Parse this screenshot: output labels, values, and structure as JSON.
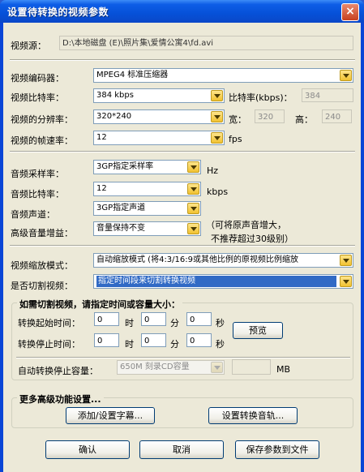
{
  "window": {
    "title": "设置待转换的视频参数",
    "close": "×"
  },
  "source": {
    "label": "视频源：",
    "value": "D:\\本地磁盘 (E)\\照片集\\爱情公寓4\\fd.avi"
  },
  "video": {
    "encoder_label": "视频编码器：",
    "encoder_value": "MPEG4 标准压缩器",
    "bitrate_label": "视频比特率：",
    "bitrate_value": "384 kbps",
    "bitrate_kbps_label": "比特率(kbps)：",
    "bitrate_kbps_value": "384",
    "resolution_label": "视频的分辨率：",
    "resolution_value": "320*240",
    "width_label": "宽：",
    "width_value": "320",
    "height_label": "高：",
    "height_value": "240",
    "framerate_label": "视频的帧速率：",
    "framerate_value": "12",
    "framerate_unit": "fps"
  },
  "audio": {
    "samplerate_label": "音频采样率：",
    "samplerate_value": "3GP指定采样率",
    "samplerate_unit": "Hz",
    "bitrate_label": "音频比特率：",
    "bitrate_value": "12",
    "bitrate_unit": "kbps",
    "channel_label": "音频声道：",
    "channel_value": "3GP指定声道",
    "gain_label": "高级音量增益：",
    "gain_value": "音量保持不变",
    "gain_note_1": "（可将原声音增大，",
    "gain_note_2": "不推荐超过30级别）"
  },
  "scale": {
    "label": "视频缩放模式：",
    "value": "自动缩放模式 (将4:3/16:9或其他比例的原视频比例缩放"
  },
  "cut": {
    "label": "是否切割视频：",
    "value": "指定时间段来切割转换视频",
    "group_title": "如需切割视频，请指定时间或容量大小：",
    "start_label": "转换起始时间：",
    "stop_label": "转换停止时间：",
    "start_h": "0",
    "start_m": "0",
    "start_s": "0",
    "stop_h": "0",
    "stop_m": "0",
    "stop_s": "0",
    "hour": "时",
    "minute": "分",
    "second": "秒",
    "preview": "预览",
    "capacity_label": "自动转换停止容量：",
    "capacity_value": "650M 刻录CD容量",
    "capacity_unit": "MB"
  },
  "advanced": {
    "title": "更多高级功能设置...",
    "subtitle_btn": "添加/设置字幕...",
    "audio_track_btn": "设置转换音轨..."
  },
  "footer": {
    "ok": "确认",
    "cancel": "取消",
    "save": "保存参数到文件"
  }
}
